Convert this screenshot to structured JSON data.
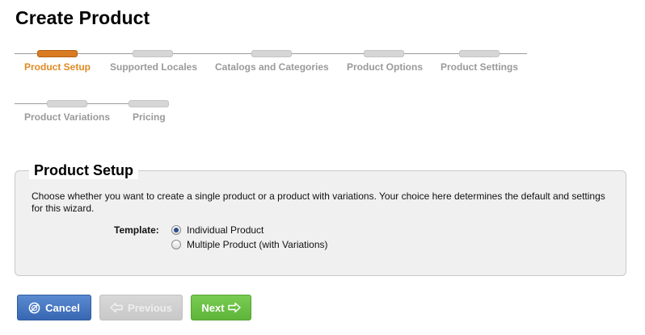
{
  "page": {
    "title": "Create Product"
  },
  "wizard": {
    "steps": [
      {
        "label": "Product Setup",
        "active": true
      },
      {
        "label": "Supported Locales",
        "active": false
      },
      {
        "label": "Catalogs and Categories",
        "active": false
      },
      {
        "label": "Product Options",
        "active": false
      },
      {
        "label": "Product Settings",
        "active": false
      },
      {
        "label": "Product Variations",
        "active": false
      },
      {
        "label": "Pricing",
        "active": false
      }
    ]
  },
  "panel": {
    "legend": "Product Setup",
    "description": "Choose whether you want to create a single product or a product with variations. Your choice here determines the default and settings for this wizard.",
    "template_label": "Template:",
    "options": [
      {
        "label": "Individual Product",
        "checked": true
      },
      {
        "label": "Multiple Product (with Variations)",
        "checked": false
      }
    ]
  },
  "buttons": {
    "cancel": {
      "label": "Cancel",
      "icon": "cancel-circle-icon"
    },
    "previous": {
      "label": "Previous",
      "icon": "arrow-left-icon",
      "disabled": true
    },
    "next": {
      "label": "Next",
      "icon": "arrow-right-icon"
    }
  },
  "colors": {
    "active_step": "#e08a23",
    "cancel": "#3f70bd",
    "next": "#6cc046",
    "disabled": "#cccccc"
  }
}
